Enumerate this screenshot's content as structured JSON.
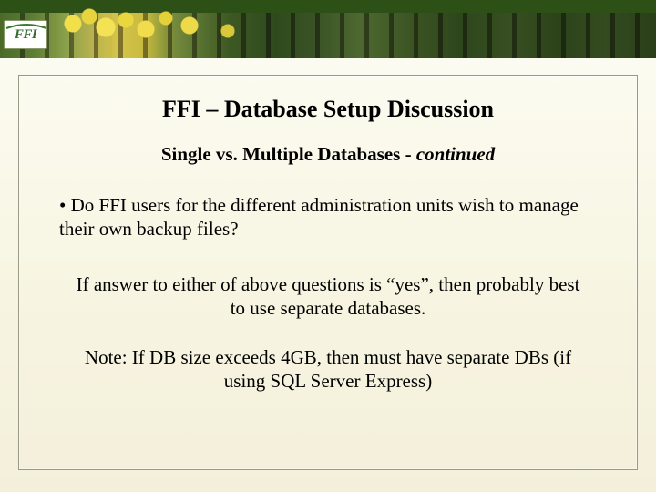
{
  "logo": {
    "text": "FFI"
  },
  "slide": {
    "title": "FFI – Database Setup Discussion",
    "subtitle_main": "Single vs. Multiple Databases - ",
    "subtitle_ital": "continued",
    "bullet1": "• Do FFI users for the different administration units wish to manage their own backup files?",
    "para1": "If answer to either of above questions is “yes”, then probably best to use separate databases.",
    "note": "Note: If DB size exceeds 4GB, then must have separate DBs (if using SQL Server Express)"
  }
}
